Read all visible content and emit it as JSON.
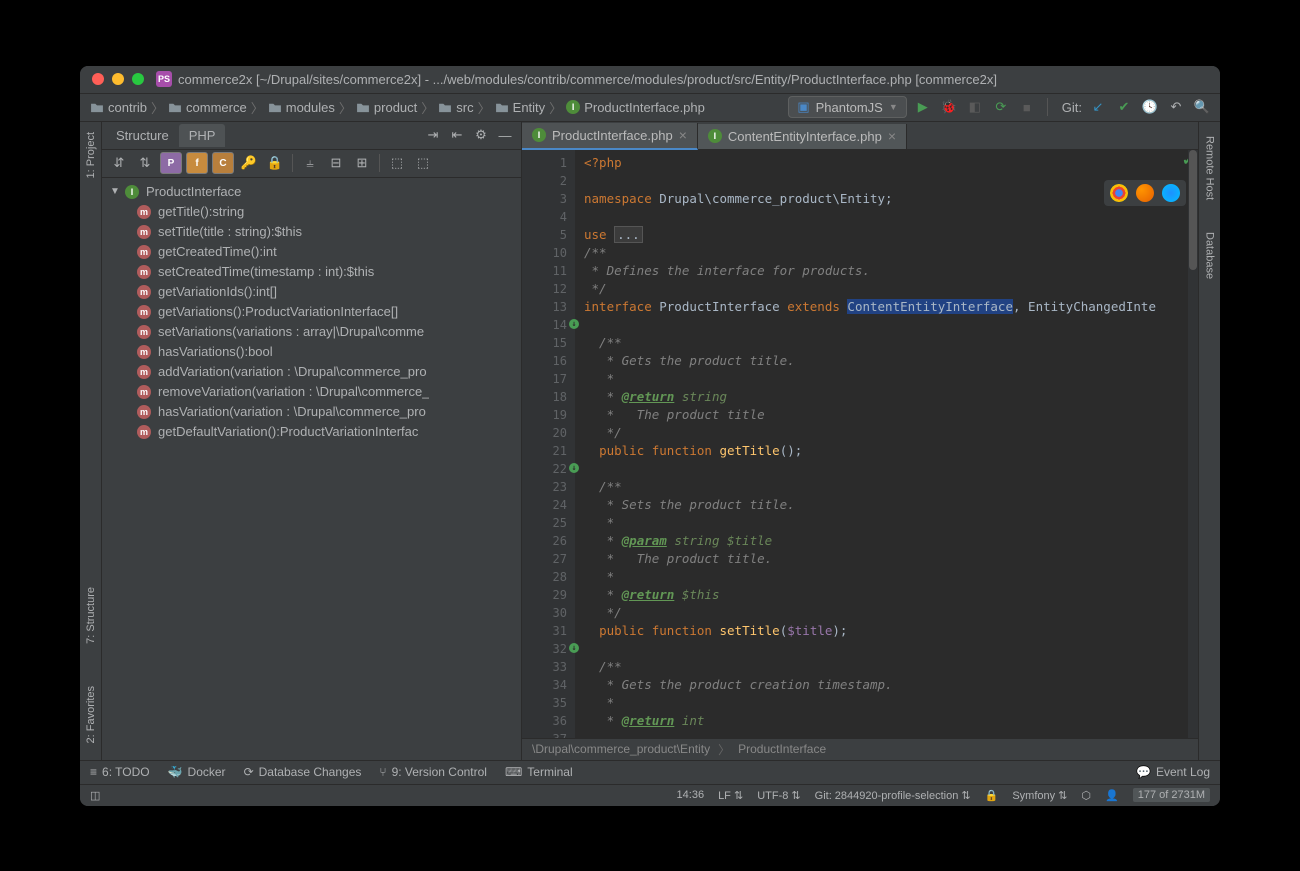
{
  "title": "commerce2x [~/Drupal/sites/commerce2x] - .../web/modules/contrib/commerce/modules/product/src/Entity/ProductInterface.php [commerce2x]",
  "breadcrumbs": [
    "contrib",
    "commerce",
    "modules",
    "product",
    "src",
    "Entity",
    "ProductInterface.php"
  ],
  "run_config": "PhantomJS",
  "git_label": "Git:",
  "left_rail": {
    "project": "1: Project",
    "structure": "7: Structure",
    "favorites": "2: Favorites"
  },
  "right_rail": {
    "remote": "Remote Host",
    "database": "Database"
  },
  "panel_tabs": {
    "structure": "Structure",
    "php": "PHP"
  },
  "structure_root": "ProductInterface",
  "structure_items": [
    "getTitle():string",
    "setTitle(title : string):$this",
    "getCreatedTime():int",
    "setCreatedTime(timestamp : int):$this",
    "getVariationIds():int[]",
    "getVariations():ProductVariationInterface[]",
    "setVariations(variations : array|\\Drupal\\comme",
    "hasVariations():bool",
    "addVariation(variation : \\Drupal\\commerce_pro",
    "removeVariation(variation : \\Drupal\\commerce_",
    "hasVariation(variation : \\Drupal\\commerce_pro",
    "getDefaultVariation():ProductVariationInterfac"
  ],
  "editor_tabs": [
    {
      "label": "ProductInterface.php",
      "active": true
    },
    {
      "label": "ContentEntityInterface.php",
      "active": false
    }
  ],
  "breadcrumb_bar": {
    "ns": "\\Drupal\\commerce_product\\Entity",
    "cls": "ProductInterface"
  },
  "bottom": {
    "todo": "6: TODO",
    "docker": "Docker",
    "db": "Database Changes",
    "vcs": "9: Version Control",
    "terminal": "Terminal",
    "eventlog": "Event Log"
  },
  "status": {
    "pos": "14:36",
    "le": "LF",
    "enc": "UTF-8",
    "branch": "Git: 2844920-profile-selection",
    "fw": "Symfony",
    "mem": "177 of 2731M"
  },
  "code": {
    "l1_php": "<?php",
    "l3_ns": "namespace",
    "l3_path": " Drupal\\commerce_product\\Entity",
    "l3_semi": ";",
    "l5_use": "use ",
    "l5_dots": "...",
    "l10": "/**",
    "l11": " * Defines the interface for products.",
    "l12": " */",
    "l14_if": "interface",
    "l14_name": " ProductInterface ",
    "l14_ext": "extends",
    "l14_sp": " ",
    "l14_ce": "ContentEntityInterface",
    "l14_rest": ", EntityChangedInte",
    "l16": "  /**",
    "l17": "   * Gets the product title.",
    "l18": "   *",
    "l19a": "   * ",
    "l19b": "@return",
    "l19c": " string",
    "l20": "   *   The product title",
    "l21": "   */",
    "l22a": "  ",
    "l22_pub": "public",
    "l22_sp1": " ",
    "l22_fn": "function",
    "l22_sp2": " ",
    "l22_name": "getTitle",
    "l22_paren": "();",
    "l24": "  /**",
    "l25": "   * Sets the product title.",
    "l26": "   *",
    "l27a": "   * ",
    "l27b": "@param",
    "l27c": " string $title",
    "l28": "   *   The product title.",
    "l29": "   *",
    "l30a": "   * ",
    "l30b": "@return",
    "l30c": " $this",
    "l31": "   */",
    "l32a": "  ",
    "l32_pub": "public",
    "l32_sp1": " ",
    "l32_fn": "function",
    "l32_sp2": " ",
    "l32_name": "setTitle",
    "l32_op": "(",
    "l32_var": "$title",
    "l32_cl": ");",
    "l34": "  /**",
    "l35": "   * Gets the product creation timestamp.",
    "l36": "   *",
    "l37a": "   * ",
    "l37b": "@return",
    "l37c": " int"
  }
}
